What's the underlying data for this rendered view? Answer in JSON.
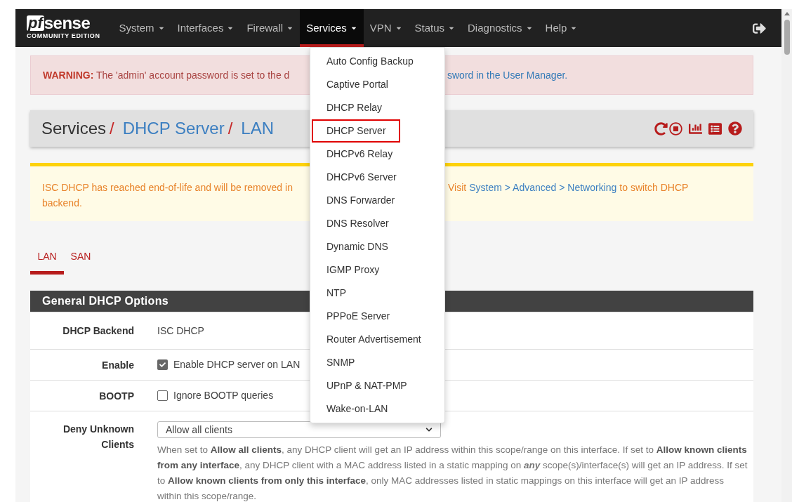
{
  "navbar": {
    "logo": {
      "mark": "pf",
      "word": "sense",
      "edition": "COMMUNITY EDITION"
    },
    "menus": [
      {
        "label": "System",
        "selected": false
      },
      {
        "label": "Interfaces",
        "selected": false
      },
      {
        "label": "Firewall",
        "selected": false
      },
      {
        "label": "Services",
        "selected": true
      },
      {
        "label": "VPN",
        "selected": false
      },
      {
        "label": "Status",
        "selected": false
      },
      {
        "label": "Diagnostics",
        "selected": false
      },
      {
        "label": "Help",
        "selected": false
      }
    ]
  },
  "services_menu": [
    {
      "label": "Auto Config Backup",
      "highlighted": false
    },
    {
      "label": "Captive Portal",
      "highlighted": false
    },
    {
      "label": "DHCP Relay",
      "highlighted": false
    },
    {
      "label": "DHCP Server",
      "highlighted": true
    },
    {
      "label": "DHCPv6 Relay",
      "highlighted": false
    },
    {
      "label": "DHCPv6 Server",
      "highlighted": false
    },
    {
      "label": "DNS Forwarder",
      "highlighted": false
    },
    {
      "label": "DNS Resolver",
      "highlighted": false
    },
    {
      "label": "Dynamic DNS",
      "highlighted": false
    },
    {
      "label": "IGMP Proxy",
      "highlighted": false
    },
    {
      "label": "NTP",
      "highlighted": false
    },
    {
      "label": "PPPoE Server",
      "highlighted": false
    },
    {
      "label": "Router Advertisement",
      "highlighted": false
    },
    {
      "label": "SNMP",
      "highlighted": false
    },
    {
      "label": "UPnP & NAT-PMP",
      "highlighted": false
    },
    {
      "label": "Wake-on-LAN",
      "highlighted": false
    }
  ],
  "warning": {
    "visible_start": "**WARNING:** The 'admin' account password is set to the d",
    "visible_end_link": "sword in the User Manager."
  },
  "breadcrumb": {
    "root": "Services",
    "separator": "/",
    "links": [
      "DHCP Server",
      "LAN"
    ]
  },
  "notice": {
    "visible_start": "ISC DHCP has reached end-of-life and will be removed in",
    "visit": "Visit",
    "link": "System > Advanced > Networking",
    "after_link": "to switch DHCP",
    "second_line": "backend."
  },
  "tabs": [
    {
      "label": "LAN",
      "selected": true
    },
    {
      "label": "SAN",
      "selected": false
    }
  ],
  "section": {
    "title": "General DHCP Options",
    "rows": [
      {
        "kind": "text",
        "label": "DHCP Backend",
        "value": "ISC DHCP"
      },
      {
        "kind": "checkbox",
        "label": "Enable",
        "value": "Enable DHCP server on LAN",
        "checked": true
      },
      {
        "kind": "checkbox",
        "label": "BOOTP",
        "value": "Ignore BOOTP queries",
        "checked": false
      },
      {
        "kind": "select",
        "label": "Deny Unknown Clients",
        "value": "Allow all clients",
        "help": "When set to **Allow all clients**, any DHCP client will get an IP address within this scope/range on this interface. If set to **Allow known clients from any interface**, any DHCP client with a MAC address listed in a static mapping on *any* scope(s)/interface(s) will get an IP address. If set to **Allow known clients from only this interface**, only MAC addresses listed in static mappings on this interface will get an IP address within this scope/range."
      }
    ]
  }
}
